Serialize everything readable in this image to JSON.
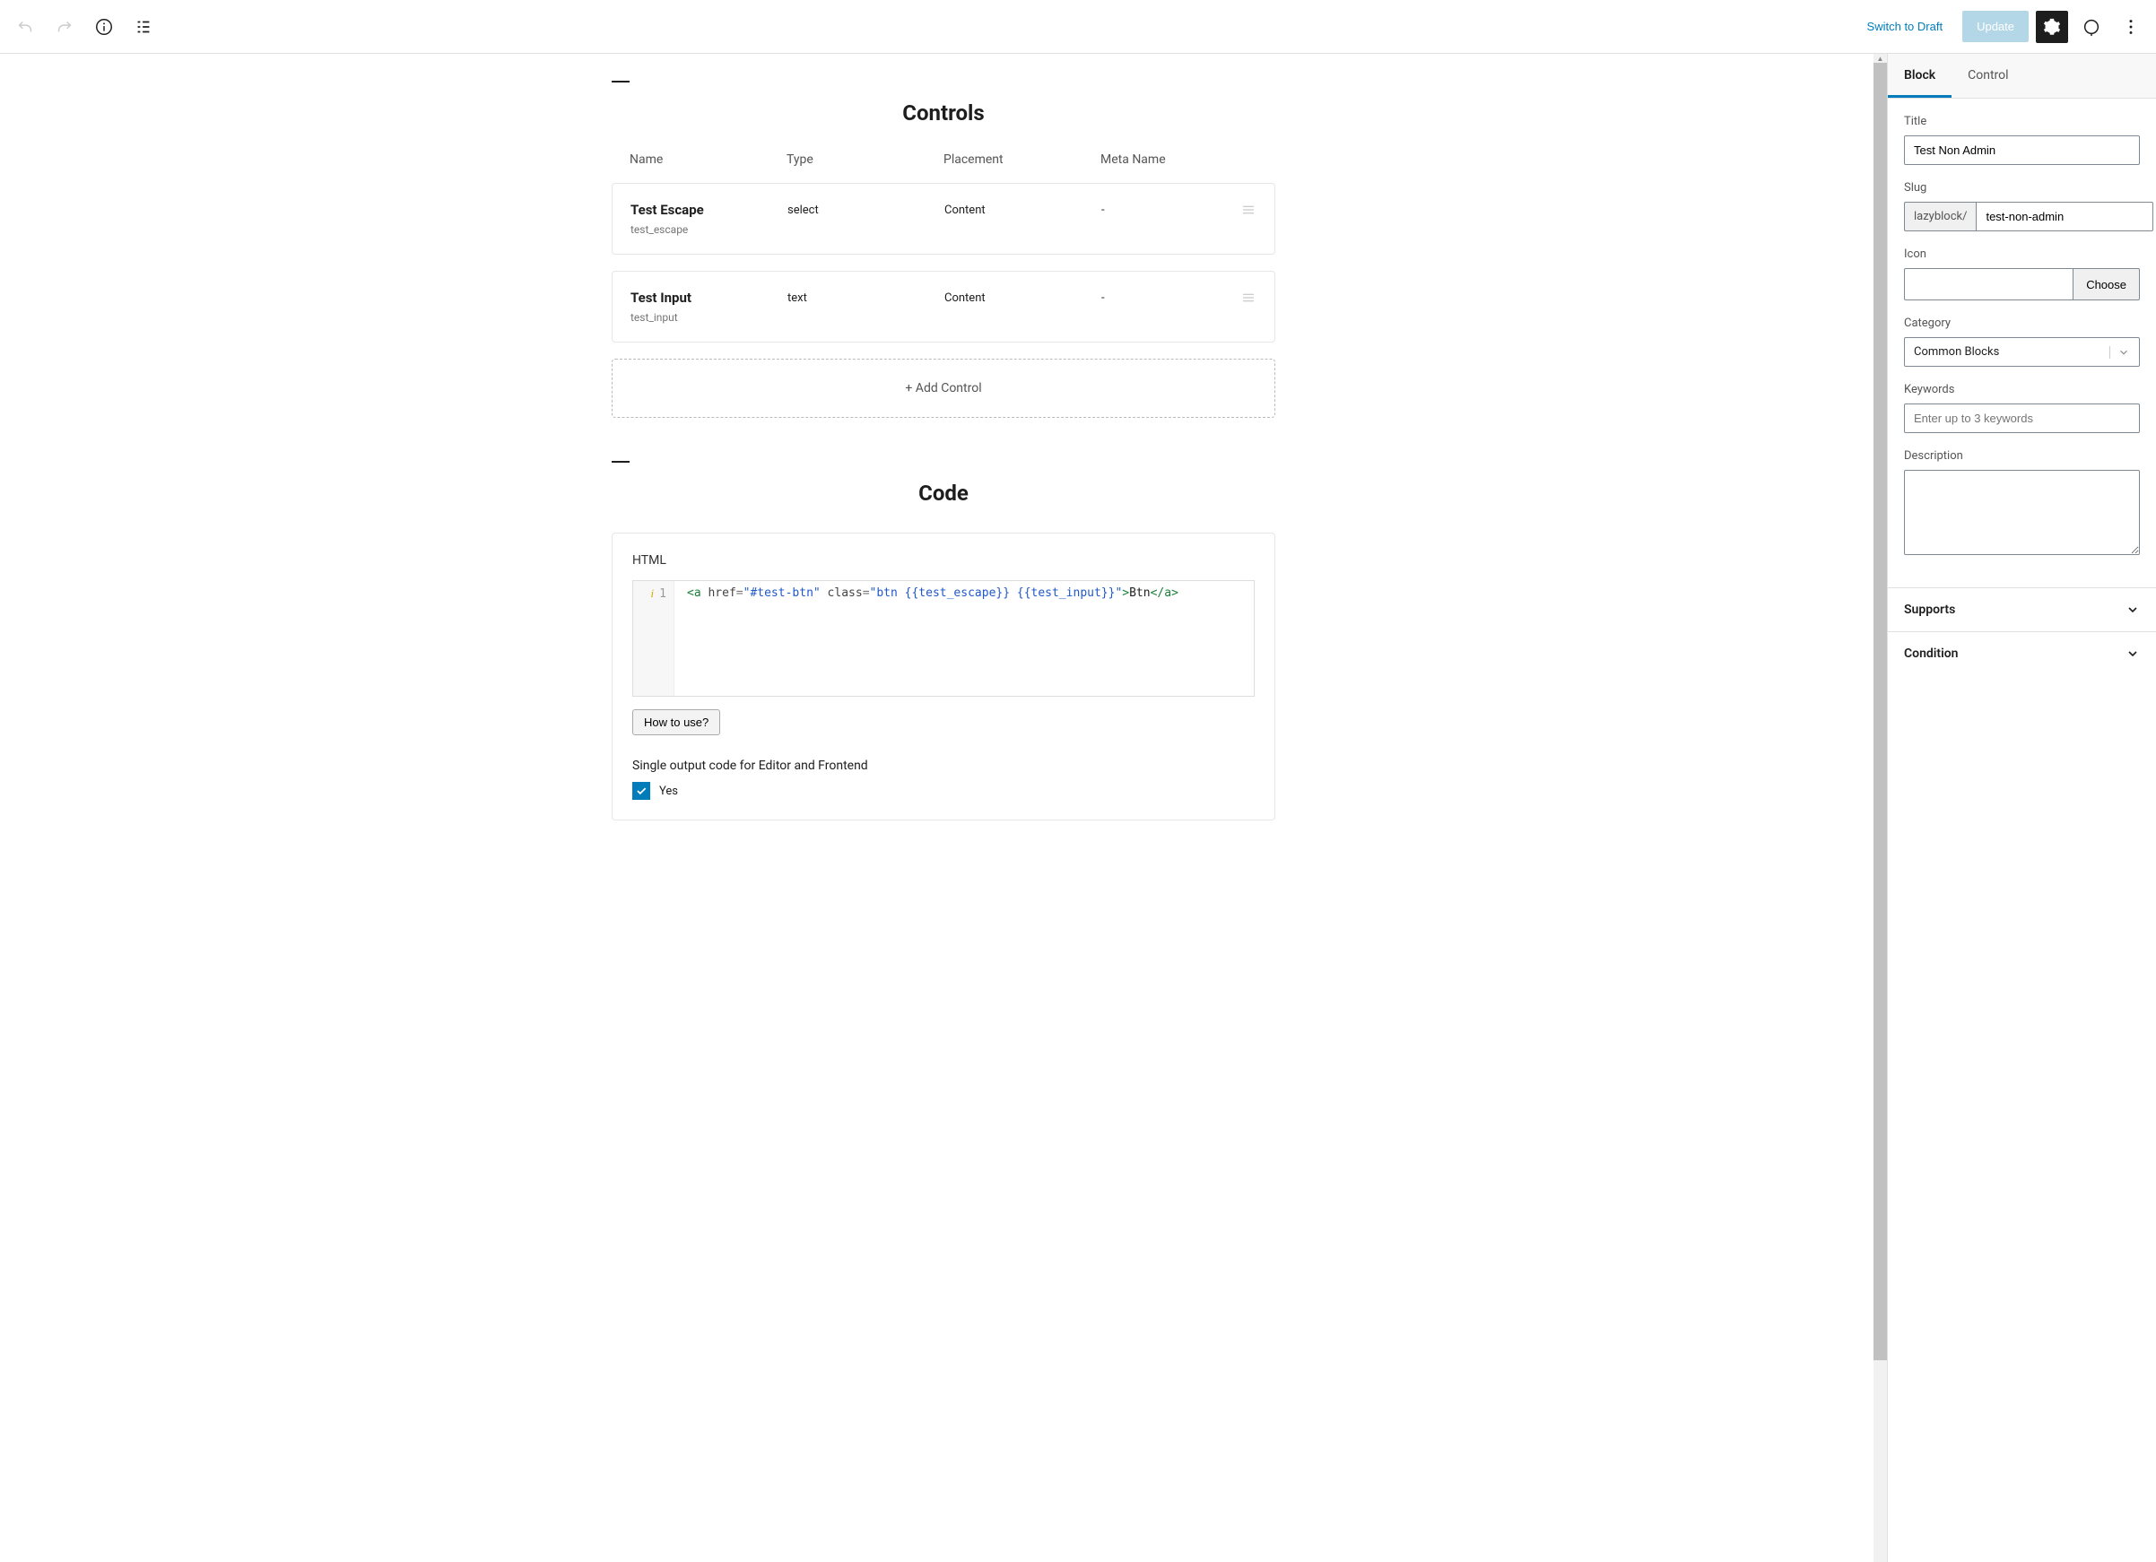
{
  "topbar": {
    "switch_to_draft": "Switch to Draft",
    "update": "Update"
  },
  "controls_section": {
    "title": "Controls",
    "columns": {
      "name": "Name",
      "type": "Type",
      "placement": "Placement",
      "meta": "Meta Name"
    },
    "items": [
      {
        "title": "Test Escape",
        "slug": "test_escape",
        "type": "select",
        "placement": "Content",
        "meta": "-"
      },
      {
        "title": "Test Input",
        "slug": "test_input",
        "type": "text",
        "placement": "Content",
        "meta": "-"
      }
    ],
    "add_control": "+ Add Control"
  },
  "code_section": {
    "title": "Code",
    "html_label": "HTML",
    "line_no": "1",
    "code": {
      "open_a": "<a",
      "href_attr": "href",
      "href_val": "\"#test-btn\"",
      "class_attr": "class",
      "class_val": "\"btn {{test_escape}} {{test_input}}\"",
      "open_close": ">",
      "text": "Btn",
      "close_a": "</a>"
    },
    "how_to_use": "How to use?",
    "single_output_label": "Single output code for Editor and Frontend",
    "yes": "Yes"
  },
  "sidebar": {
    "tabs": {
      "block": "Block",
      "control": "Control"
    },
    "title_label": "Title",
    "title_value": "Test Non Admin",
    "slug_label": "Slug",
    "slug_prefix": "lazyblock/",
    "slug_value": "test-non-admin",
    "icon_label": "Icon",
    "choose": "Choose",
    "category_label": "Category",
    "category_value": "Common Blocks",
    "keywords_label": "Keywords",
    "keywords_placeholder": "Enter up to 3 keywords",
    "description_label": "Description",
    "supports": "Supports",
    "condition": "Condition"
  }
}
